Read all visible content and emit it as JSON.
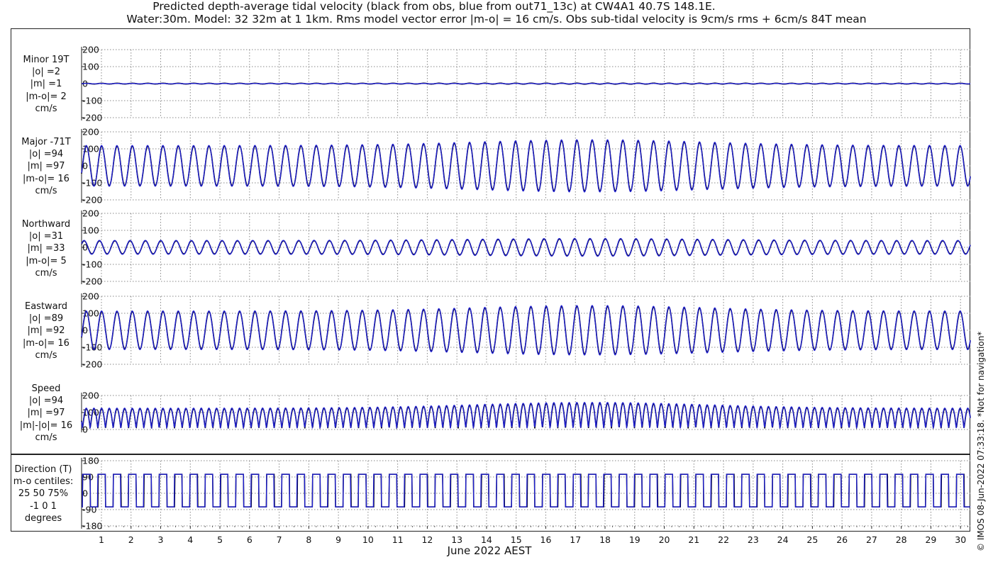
{
  "title_line1": "Predicted depth-average tidal velocity (black from obs, blue from out71_13c) at CW4A1 40.7S 148.1E.",
  "title_line2": "Water:30m. Model: 32 32m at 1 1km. Rms model vector error |m-o| = 16 cm/s. Obs sub-tidal velocity is 9cm/s rms + 6cm/s 84T mean",
  "xlabel": "June 2022 AEST",
  "credit": "© IMOS 08-Jun-2022 07:33:18. *Not for navigation*",
  "colors": {
    "obs": "#000000",
    "model": "#1f1fd0",
    "grid": "#888888"
  },
  "chart_data": [
    {
      "type": "line",
      "name": "minor",
      "label_lines": [
        "Minor 19T",
        "|o| =2",
        "|m| =1",
        "|m-o|= 2",
        "cm/s"
      ],
      "ylim": [
        -200,
        200
      ],
      "yticks": [
        -200,
        -100,
        0,
        100,
        200
      ],
      "amplitude": {
        "obs": 2,
        "model": 1
      },
      "series": [
        {
          "name": "black from obs"
        },
        {
          "name": "blue from out71_13c"
        }
      ]
    },
    {
      "type": "line",
      "name": "major",
      "label_lines": [
        "Major -71T",
        "|o| =94",
        "|m| =97",
        "|m-o|= 16",
        "cm/s"
      ],
      "ylim": [
        -200,
        200
      ],
      "yticks": [
        -200,
        -100,
        0,
        100,
        200
      ],
      "amplitude": {
        "obs": 94,
        "model": 97
      },
      "series": [
        {
          "name": "black from obs"
        },
        {
          "name": "blue from out71_13c"
        }
      ]
    },
    {
      "type": "line",
      "name": "northward",
      "label_lines": [
        "Northward",
        "|o| =31",
        "|m| =33",
        "|m-o|= 5",
        "cm/s"
      ],
      "ylim": [
        -200,
        200
      ],
      "yticks": [
        -200,
        -100,
        0,
        100,
        200
      ],
      "amplitude": {
        "obs": 31,
        "model": 33
      },
      "series": [
        {
          "name": "black from obs"
        },
        {
          "name": "blue from out71_13c"
        }
      ]
    },
    {
      "type": "line",
      "name": "eastward",
      "label_lines": [
        "Eastward",
        "|o| =89",
        "|m| =92",
        "|m-o|= 16",
        "cm/s"
      ],
      "ylim": [
        -200,
        200
      ],
      "yticks": [
        -200,
        -100,
        0,
        100,
        200
      ],
      "amplitude": {
        "obs": 89,
        "model": 92
      },
      "series": [
        {
          "name": "black from obs"
        },
        {
          "name": "blue from out71_13c"
        }
      ]
    },
    {
      "type": "line",
      "name": "speed",
      "label_lines": [
        "Speed",
        "|o| =94",
        "|m| =97",
        "|m|-|o|= 16",
        "cm/s"
      ],
      "ylim": [
        0,
        200
      ],
      "yticks": [
        0,
        100,
        200
      ],
      "amplitude": {
        "obs": 94,
        "model": 97
      },
      "series": [
        {
          "name": "black from obs"
        },
        {
          "name": "blue from out71_13c"
        }
      ]
    },
    {
      "type": "line",
      "name": "direction",
      "label_lines": [
        "Direction (T)",
        "m-o centiles:",
        "25  50  75%",
        "-1  0  1",
        "degrees"
      ],
      "ylim": [
        -180,
        180
      ],
      "yticks": [
        -180,
        -90,
        0,
        90,
        180
      ],
      "series": [
        {
          "name": "black from obs"
        },
        {
          "name": "blue from out71_13c"
        }
      ]
    }
  ],
  "x_axis": {
    "ticks": [
      1,
      2,
      3,
      4,
      5,
      6,
      7,
      8,
      9,
      10,
      11,
      12,
      13,
      14,
      15,
      16,
      17,
      18,
      19,
      20,
      21,
      22,
      23,
      24,
      25,
      26,
      27,
      28,
      29,
      30
    ],
    "xlim": [
      0.33,
      30.33
    ],
    "grid": true
  }
}
